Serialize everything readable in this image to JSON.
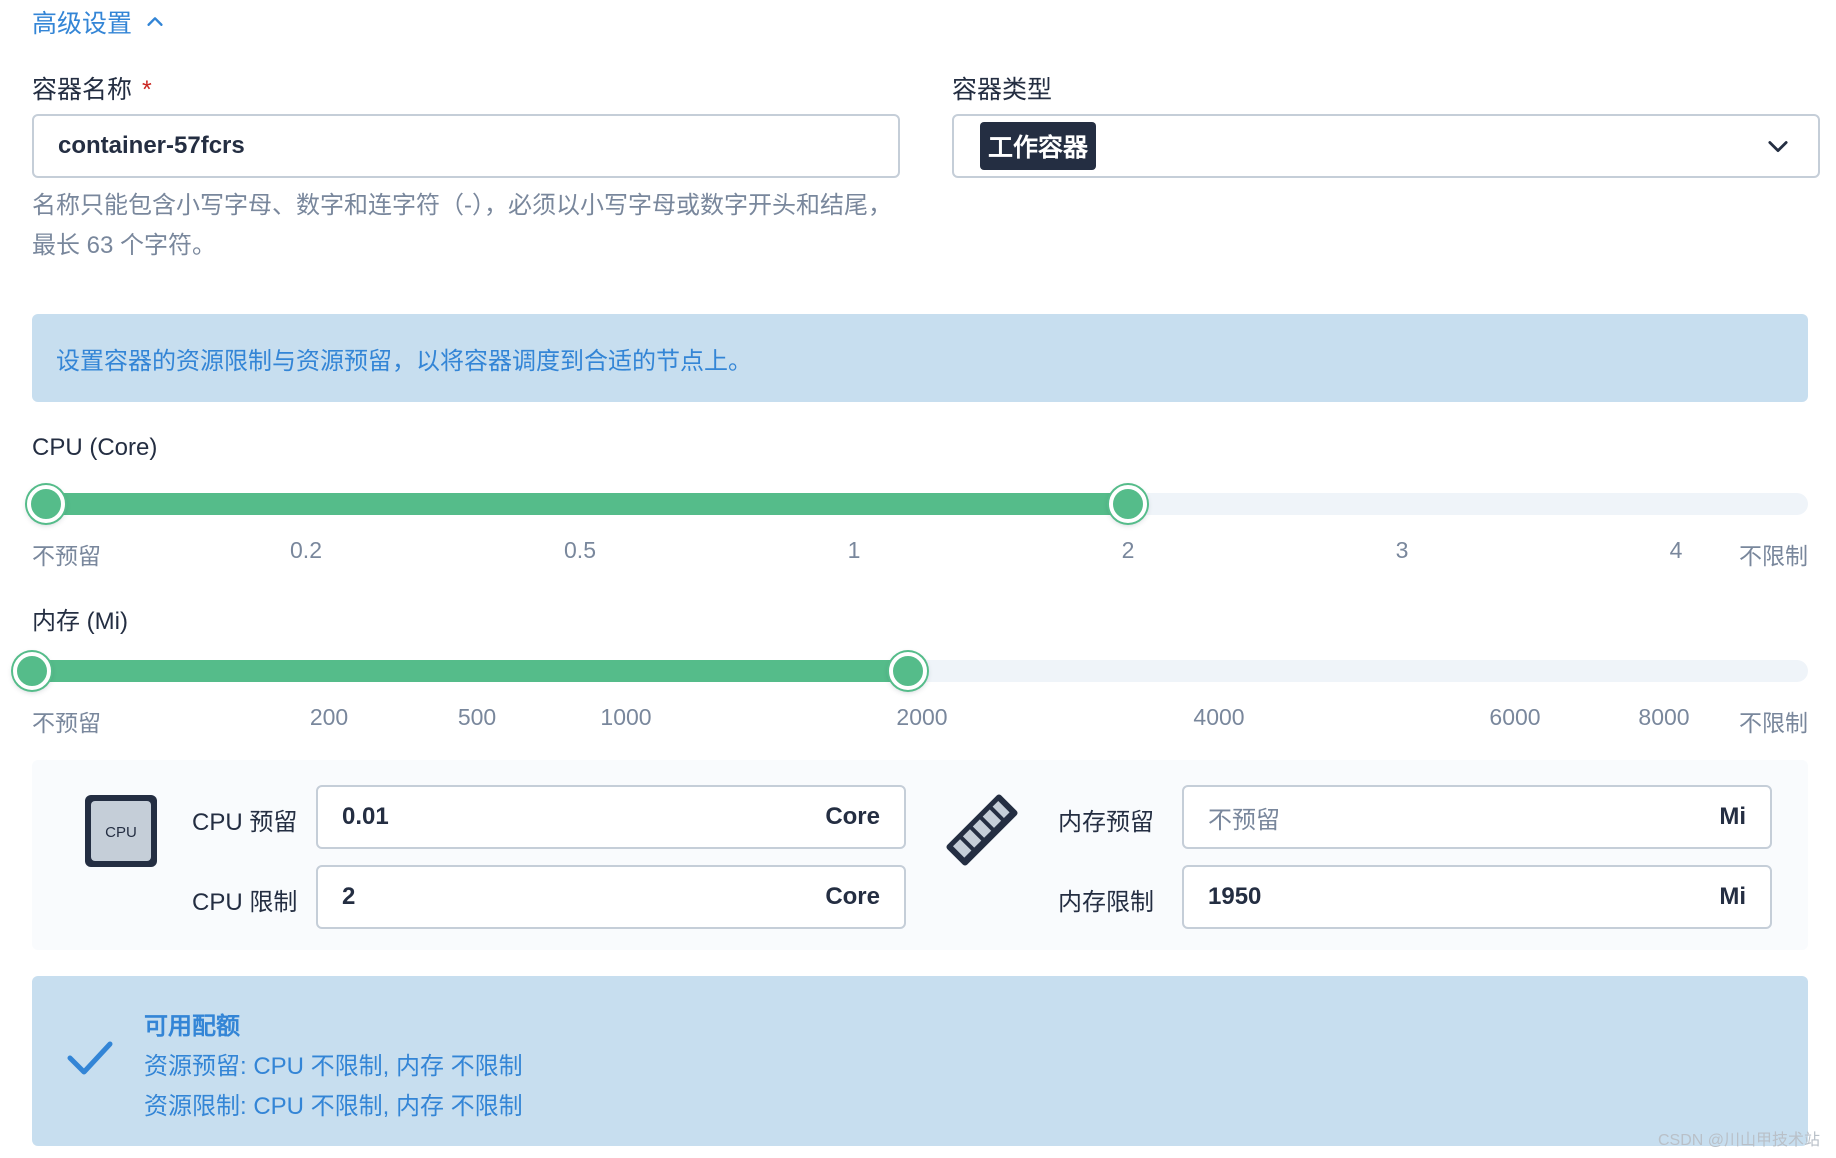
{
  "section": {
    "title": "高级设置",
    "icon": "chevron-up-icon"
  },
  "container_name": {
    "label": "容器名称",
    "required_mark": "*",
    "value": "container-57fcrs",
    "hint": "名称只能包含小写字母、数字和连字符（-），必须以小写字母或数字开头和结尾，最长 63 个字符。"
  },
  "container_type": {
    "label": "容器类型",
    "selected": "工作容器",
    "icon": "chevron-down-icon"
  },
  "info_banner": {
    "text": "设置容器的资源限制与资源预留，以将容器调度到合适的节点上。"
  },
  "cpu_slider": {
    "title": "CPU (Core)",
    "ticks": [
      "不预留",
      "0.2",
      "0.5",
      "1",
      "2",
      "3",
      "4",
      "不限制"
    ],
    "reserve_tick_index": 0,
    "limit_tick_index": 4
  },
  "memory_slider": {
    "title": "内存 (Mi)",
    "ticks": [
      "不预留",
      "200",
      "500",
      "1000",
      "2000",
      "4000",
      "6000",
      "8000",
      "不限制"
    ],
    "reserve_tick_index": 0,
    "limit_value": 1950
  },
  "resources": {
    "cpu_icon_text": "CPU",
    "cpu_reserve": {
      "label": "CPU 预留",
      "value": "0.01",
      "unit": "Core"
    },
    "cpu_limit": {
      "label": "CPU 限制",
      "value": "2",
      "unit": "Core"
    },
    "memory_reserve": {
      "label": "内存预留",
      "placeholder": "不预留",
      "unit": "Mi"
    },
    "memory_limit": {
      "label": "内存限制",
      "value": "1950",
      "unit": "Mi"
    }
  },
  "quota": {
    "title": "可用配额",
    "reserve_line": "资源预留:  CPU 不限制, 内存 不限制",
    "limit_line": "资源限制:  CPU 不限制, 内存 不限制",
    "icon": "checkmark-icon"
  },
  "watermark": "CSDN @川山甲技术站",
  "colors": {
    "accent": "#3385d6",
    "slider": "#55bc8a",
    "banner": "#c7deef",
    "text": "#242e42",
    "muted": "#79879c"
  }
}
